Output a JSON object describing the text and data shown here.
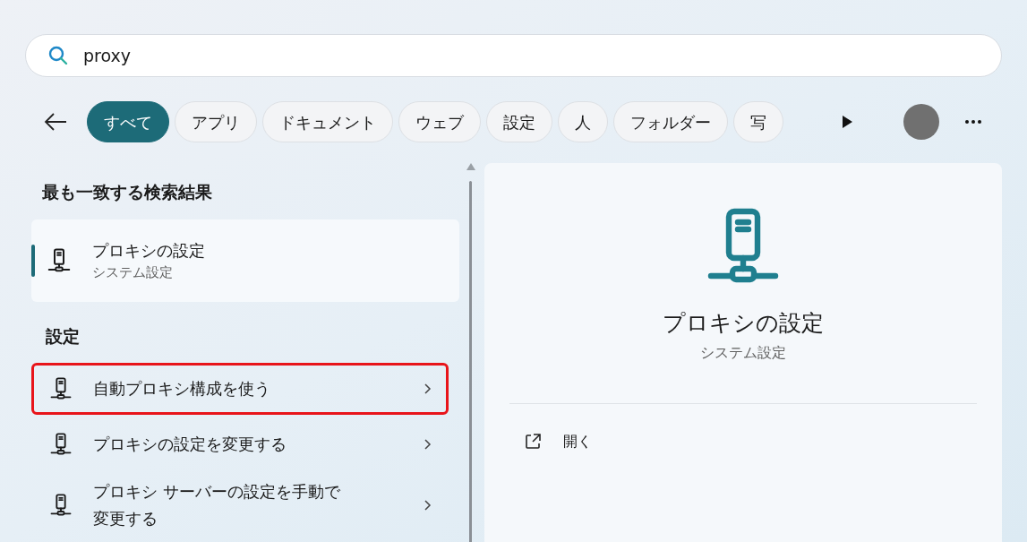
{
  "search": {
    "value": "proxy"
  },
  "filters": [
    {
      "label": "すべて",
      "selected": true
    },
    {
      "label": "アプリ",
      "selected": false
    },
    {
      "label": "ドキュメント",
      "selected": false
    },
    {
      "label": "ウェブ",
      "selected": false
    },
    {
      "label": "設定",
      "selected": false
    },
    {
      "label": "人",
      "selected": false
    },
    {
      "label": "フォルダー",
      "selected": false
    },
    {
      "label": "写",
      "selected": false
    }
  ],
  "best_match": {
    "heading": "最も一致する検索結果",
    "title": "プロキシの設定",
    "subtitle": "システム設定",
    "selected": true
  },
  "settings_section": {
    "heading": "設定",
    "items": [
      {
        "label": "自動プロキシ構成を使う",
        "highlighted": true
      },
      {
        "label": "プロキシの設定を変更する",
        "highlighted": false
      },
      {
        "label": "プロキシ サーバーの設定を手動で変更する",
        "highlighted": false
      }
    ]
  },
  "preview": {
    "title": "プロキシの設定",
    "subtitle": "システム設定",
    "actions": [
      {
        "label": "開く"
      }
    ]
  }
}
